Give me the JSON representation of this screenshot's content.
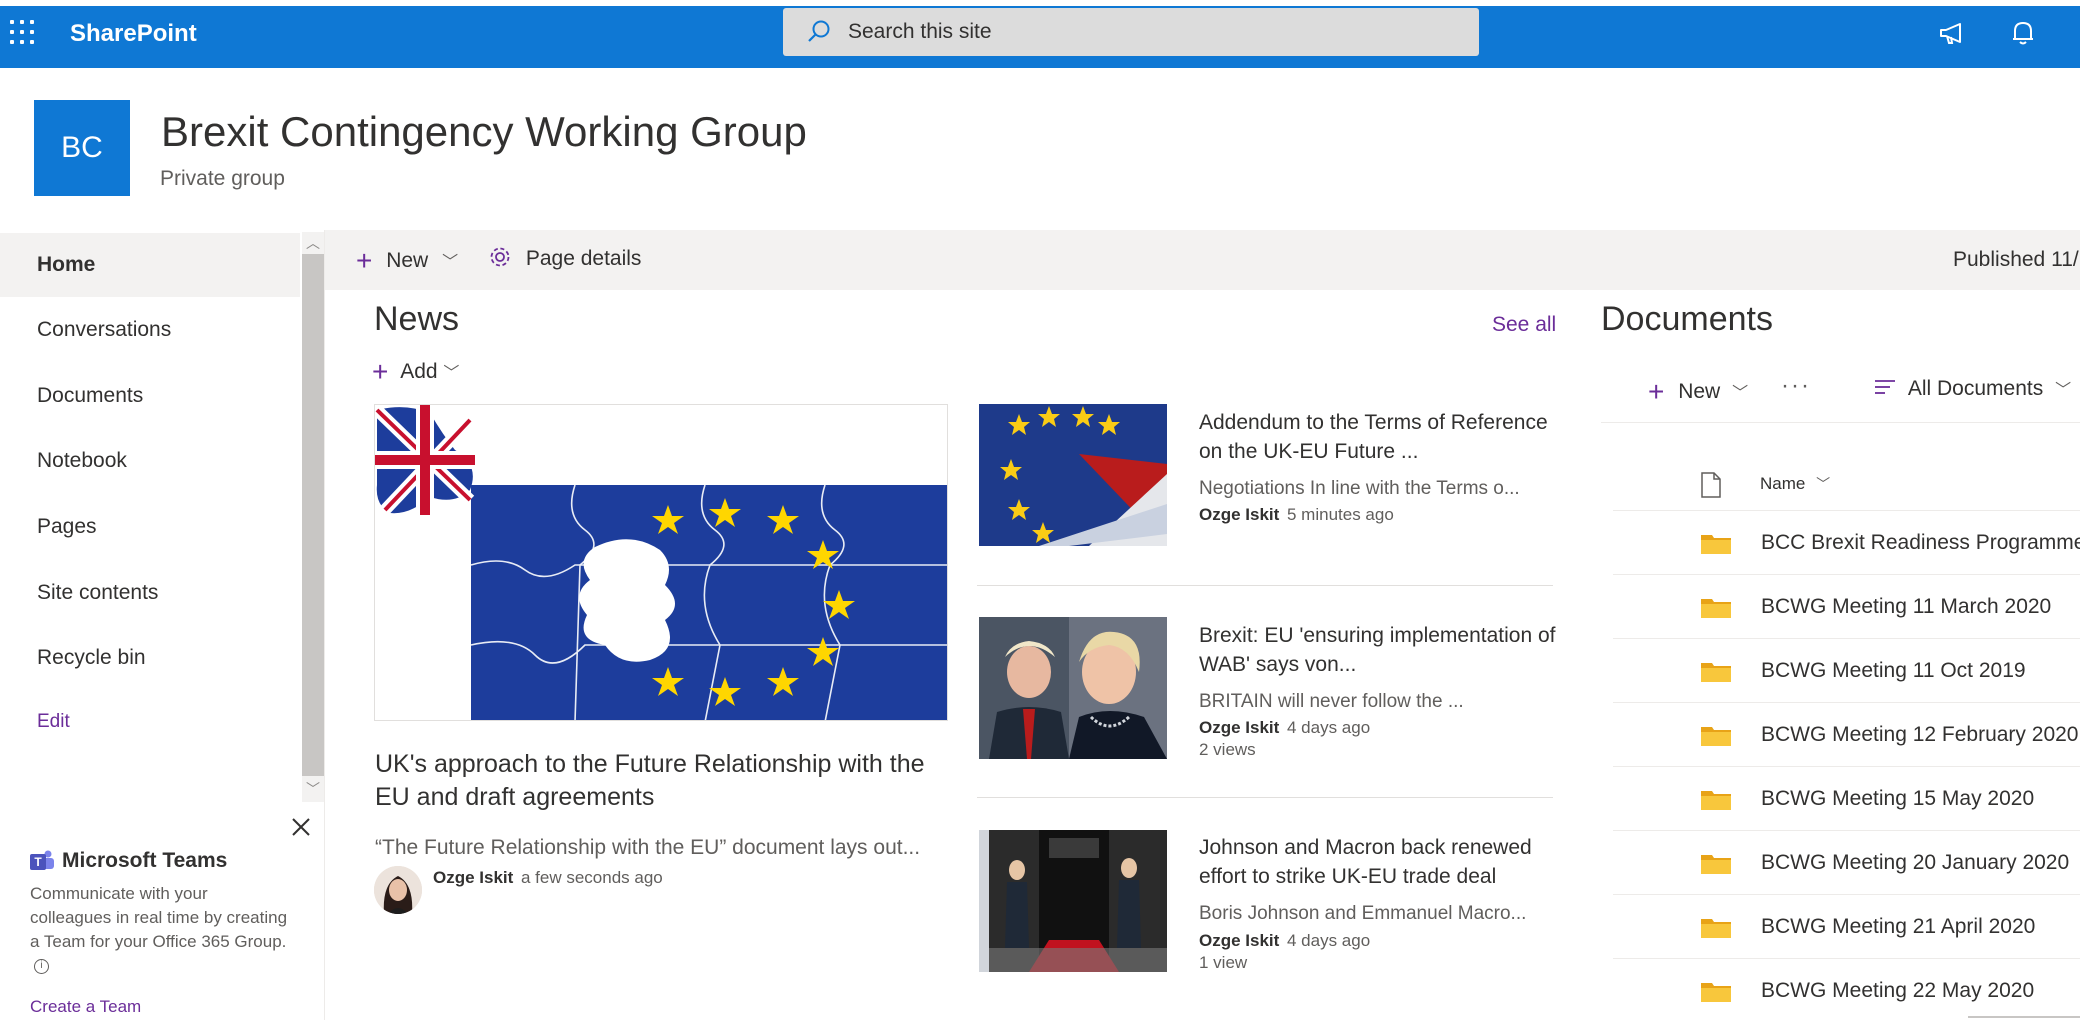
{
  "suite": {
    "brand": "SharePoint",
    "search_placeholder": "Search this site"
  },
  "site": {
    "logo_initials": "BC",
    "title": "Brexit Contingency Working Group",
    "subtitle": "Private group"
  },
  "nav": {
    "items": [
      {
        "label": "Home",
        "active": true
      },
      {
        "label": "Conversations"
      },
      {
        "label": "Documents"
      },
      {
        "label": "Notebook"
      },
      {
        "label": "Pages"
      },
      {
        "label": "Site contents"
      },
      {
        "label": "Recycle bin"
      }
    ],
    "edit_label": "Edit"
  },
  "teams_card": {
    "title": "Microsoft Teams",
    "description": "Communicate with your colleagues in real time by creating a Team for your Office 365 Group.",
    "cta": "Create a Team"
  },
  "command_bar": {
    "new_label": "New",
    "page_details_label": "Page details",
    "published": "Published 11/"
  },
  "news": {
    "title": "News",
    "see_all": "See all",
    "add_label": "Add",
    "hero": {
      "title": "UK's approach to the Future Relationship with the EU and draft agreements",
      "description": "“The Future Relationship with the EU” document lays out...",
      "author": "Ozge Iskit",
      "time": "a few seconds ago"
    },
    "items": [
      {
        "title": "Addendum to the Terms of Reference on the UK-EU Future ...",
        "description": "Negotiations In line with the Terms o...",
        "author": "Ozge Iskit",
        "time": "5 minutes ago",
        "views": ""
      },
      {
        "title": "Brexit: EU 'ensuring implementation of WAB' says von...",
        "description": "BRITAIN will never follow the ...",
        "author": "Ozge Iskit",
        "time": "4 days ago",
        "views": "2 views"
      },
      {
        "title": "Johnson and Macron back renewed effort to strike UK-EU trade deal",
        "description": "Boris Johnson and Emmanuel Macro...",
        "author": "Ozge Iskit",
        "time": "4 days ago",
        "views": "1 view"
      }
    ]
  },
  "documents": {
    "title": "Documents",
    "new_label": "New",
    "more_label": "···",
    "view_label": "All Documents",
    "name_header": "Name",
    "folders": [
      "BCC Brexit Readiness Programme",
      "BCWG Meeting 11 March 2020",
      "BCWG Meeting 11 Oct 2019",
      "BCWG Meeting 12 February 2020",
      "BCWG Meeting 15 May 2020",
      "BCWG Meeting 20 January 2020",
      "BCWG Meeting 21 April 2020",
      "BCWG Meeting 22 May 2020"
    ]
  },
  "colors": {
    "brand_blue": "#0f78d4",
    "accent_purple": "#6b2d99",
    "folder_yellow": "#f8c73c"
  }
}
